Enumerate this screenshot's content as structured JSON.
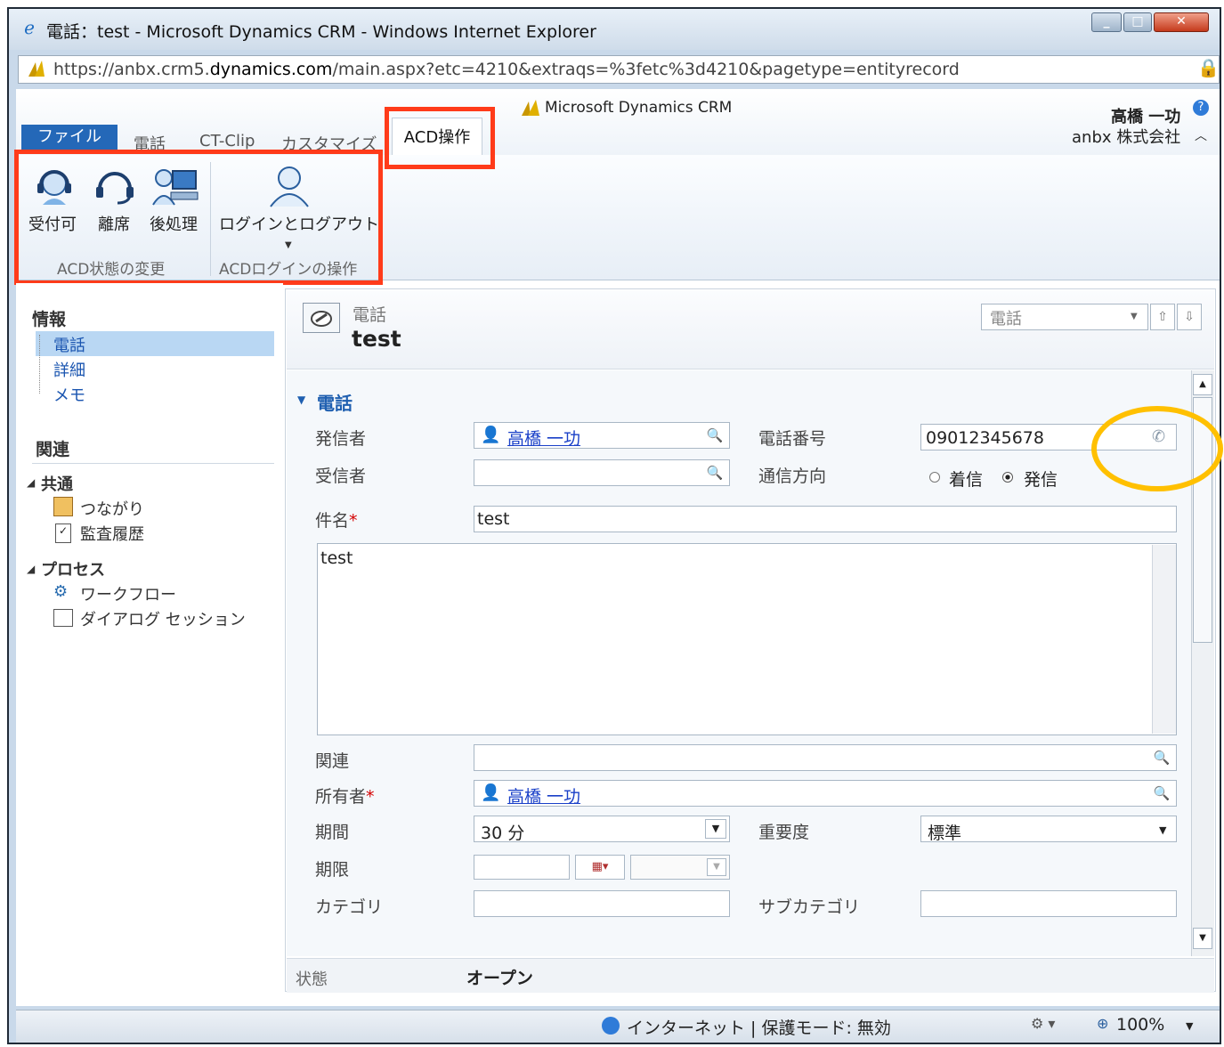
{
  "window": {
    "title": "電話：test - Microsoft Dynamics CRM - Windows Internet Explorer",
    "url_prefix": "https://anbx.crm5.",
    "url_domain": "dynamics.com",
    "url_path": "/main.aspx?etc=4210&extraqs=%3fetc%3d4210&pagetype=entityrecord"
  },
  "header": {
    "brand": "Microsoft Dynamics CRM",
    "user_name": "高橋 一功",
    "org_name": "anbx 株式会社"
  },
  "ribbon": {
    "tabs": {
      "file": "ファイル",
      "phone": "電話",
      "ctclip": "CT-Clip",
      "customize": "カスタマイズ",
      "acd": "ACD操作"
    },
    "buttons": {
      "available": "受付可",
      "away": "離席",
      "after_work": "後処理",
      "login_logout": "ログインとログアウト"
    },
    "groups": {
      "state_change": "ACD状態の変更",
      "login_ops": "ACDログインの操作"
    }
  },
  "nav": {
    "info_title": "情報",
    "info_items": [
      "電話",
      "詳細",
      "メモ"
    ],
    "related_title": "関連",
    "common_title": "共通",
    "common_items": [
      "つながり",
      "監査履歴"
    ],
    "process_title": "プロセス",
    "process_items": [
      "ワークフロー",
      "ダイアログ セッション"
    ]
  },
  "record": {
    "entity": "電話",
    "name": "test",
    "view_select": "電話"
  },
  "form": {
    "section": "電話",
    "from_label": "発信者",
    "from_value": "高橋 一功",
    "to_label": "受信者",
    "phone_label": "電話番号",
    "phone_value": "09012345678",
    "direction_label": "通信方向",
    "direction_in": "着信",
    "direction_out": "発信",
    "subject_label": "件名",
    "subject_value": "test",
    "description_value": "test",
    "regarding_label": "関連",
    "owner_label": "所有者",
    "owner_value": "高橋 一功",
    "duration_label": "期間",
    "duration_value": "30 分",
    "priority_label": "重要度",
    "priority_value": "標準",
    "due_label": "期限",
    "category_label": "カテゴリ",
    "subcategory_label": "サブカテゴリ",
    "required_mark": "*"
  },
  "status": {
    "label": "状態",
    "value": "オープン"
  },
  "statusbar": {
    "zone": "インターネット | 保護モード: 無効",
    "zoom": "100%"
  },
  "colors": {
    "highlight_red": "#ff3b1a",
    "highlight_yellow": "#ffc000",
    "file_tab": "#2468b8"
  }
}
